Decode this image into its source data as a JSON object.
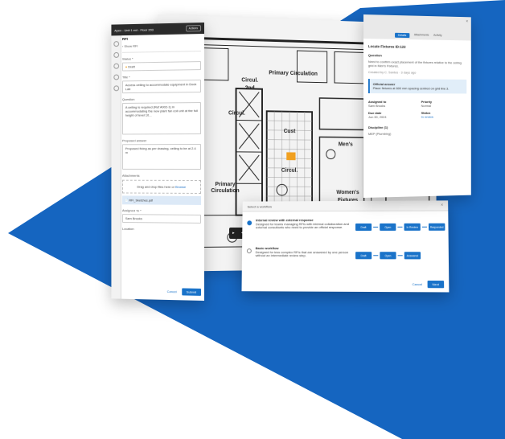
{
  "colors": {
    "brand_blue": "#1565c0",
    "accent": "#1a73c9",
    "panel_dark": "#2b2b2b"
  },
  "blueprint": {
    "labels": [
      "Primary Circulation",
      "Circul.",
      "2nd",
      "Cust",
      "Circul.",
      "Primary Circulation",
      "Men's",
      "Women's",
      "Fixtures",
      "Circul."
    ]
  },
  "left_panel": {
    "topbar_title": "Apex - Unit 1 ext - Floor 203",
    "topbar_btn": "Actions",
    "section": "RFI",
    "back_link": "Show RFI",
    "status_label": "Status *",
    "status_value": "Draft",
    "title_label": "Title *",
    "title_value": "Access ceiling to accommodate equipment in Dock Lab",
    "question_label": "Question",
    "question_text": "A ceiling is required (Ref A002-1) in accommodating the new plant fan coil unit at the full height of level 10...",
    "question_link": "Ref A002-1",
    "response_label": "Proposed answer",
    "response_text": "Proposed fixing as per drawing, ceiling to be at 2.4 m",
    "attachments_label": "Attachments",
    "attach_drop": "Drag and drop files here or",
    "attach_browse": "Browse",
    "attach_file": "RFI_Sketches.pdf",
    "assignee_label": "Assigned To *",
    "assignee_value": "Sam Brooks",
    "location_label": "Location",
    "cancel": "Cancel",
    "submit": "Submit"
  },
  "right_panel": {
    "tabs": [
      "Details",
      "Attachments",
      "Activity"
    ],
    "close": "×",
    "rfi_title": "Locate Fixtures ID:122",
    "question_head": "Question",
    "question_text": "Need to confirm exact placement of the fixtures relative to the ceiling grid in Men's Fixtures.",
    "meta_text": "Created by C. Santos · 3 days ago",
    "response_head": "Official answer",
    "response_text": "Place fixtures at 600 mm spacing centred on grid line 3.",
    "grid": [
      {
        "k": "Assigned to",
        "v": "Sam Brooks"
      },
      {
        "k": "Priority",
        "v": "Normal"
      },
      {
        "k": "Due date",
        "v": "Jun 30, 2024"
      },
      {
        "k": "Status",
        "v": "In review"
      }
    ],
    "custom_head": "Discipline (1)",
    "custom_value": "MEP (Plumbing)"
  },
  "workflow": {
    "title": "Select a workflow",
    "close": "×",
    "options": [
      {
        "name": "Internal review with external response",
        "text": "Designed for teams managing RFIs with internal collaboration and external consultants who need to provide an official response.",
        "nodes": [
          "Draft",
          "Open",
          "In Review",
          "Responded"
        ]
      },
      {
        "name": "Basic workflow",
        "text": "Designed for less complex RFIs that are answered by one person without an intermediate review step.",
        "nodes": [
          "Draft",
          "Open",
          "Answered"
        ]
      }
    ],
    "cancel": "Cancel",
    "next": "Next"
  },
  "mini_toolbar": {
    "icons": [
      "select-icon",
      "pin-icon"
    ]
  }
}
